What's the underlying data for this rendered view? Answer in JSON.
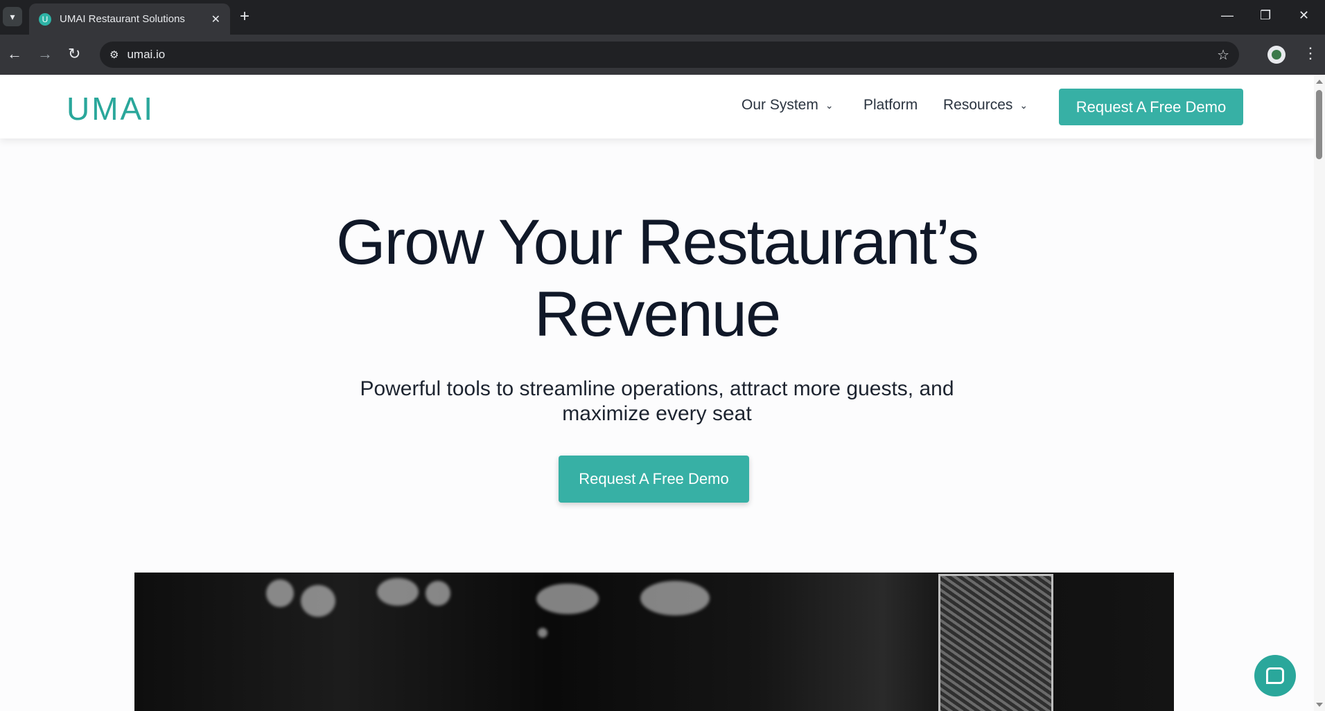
{
  "browser": {
    "tab_title": "UMAI Restaurant Solutions",
    "favicon_letter": "U",
    "url": "umai.io"
  },
  "header": {
    "logo": "UMAI",
    "nav": [
      {
        "label": "Our System",
        "has_dropdown": true
      },
      {
        "label": "Platform",
        "has_dropdown": false
      },
      {
        "label": "Resources",
        "has_dropdown": true
      }
    ],
    "cta_label": "Request A Free Demo"
  },
  "hero": {
    "title_line1": "Grow Your Restaurant’s",
    "title_line2": "Revenue",
    "subtitle_line1": "Powerful tools to streamline operations, attract more guests, and",
    "subtitle_line2": "maximize every seat",
    "cta_label": "Request A Free Demo"
  },
  "colors": {
    "brand_teal": "#37b0a5",
    "heading": "#101828"
  }
}
